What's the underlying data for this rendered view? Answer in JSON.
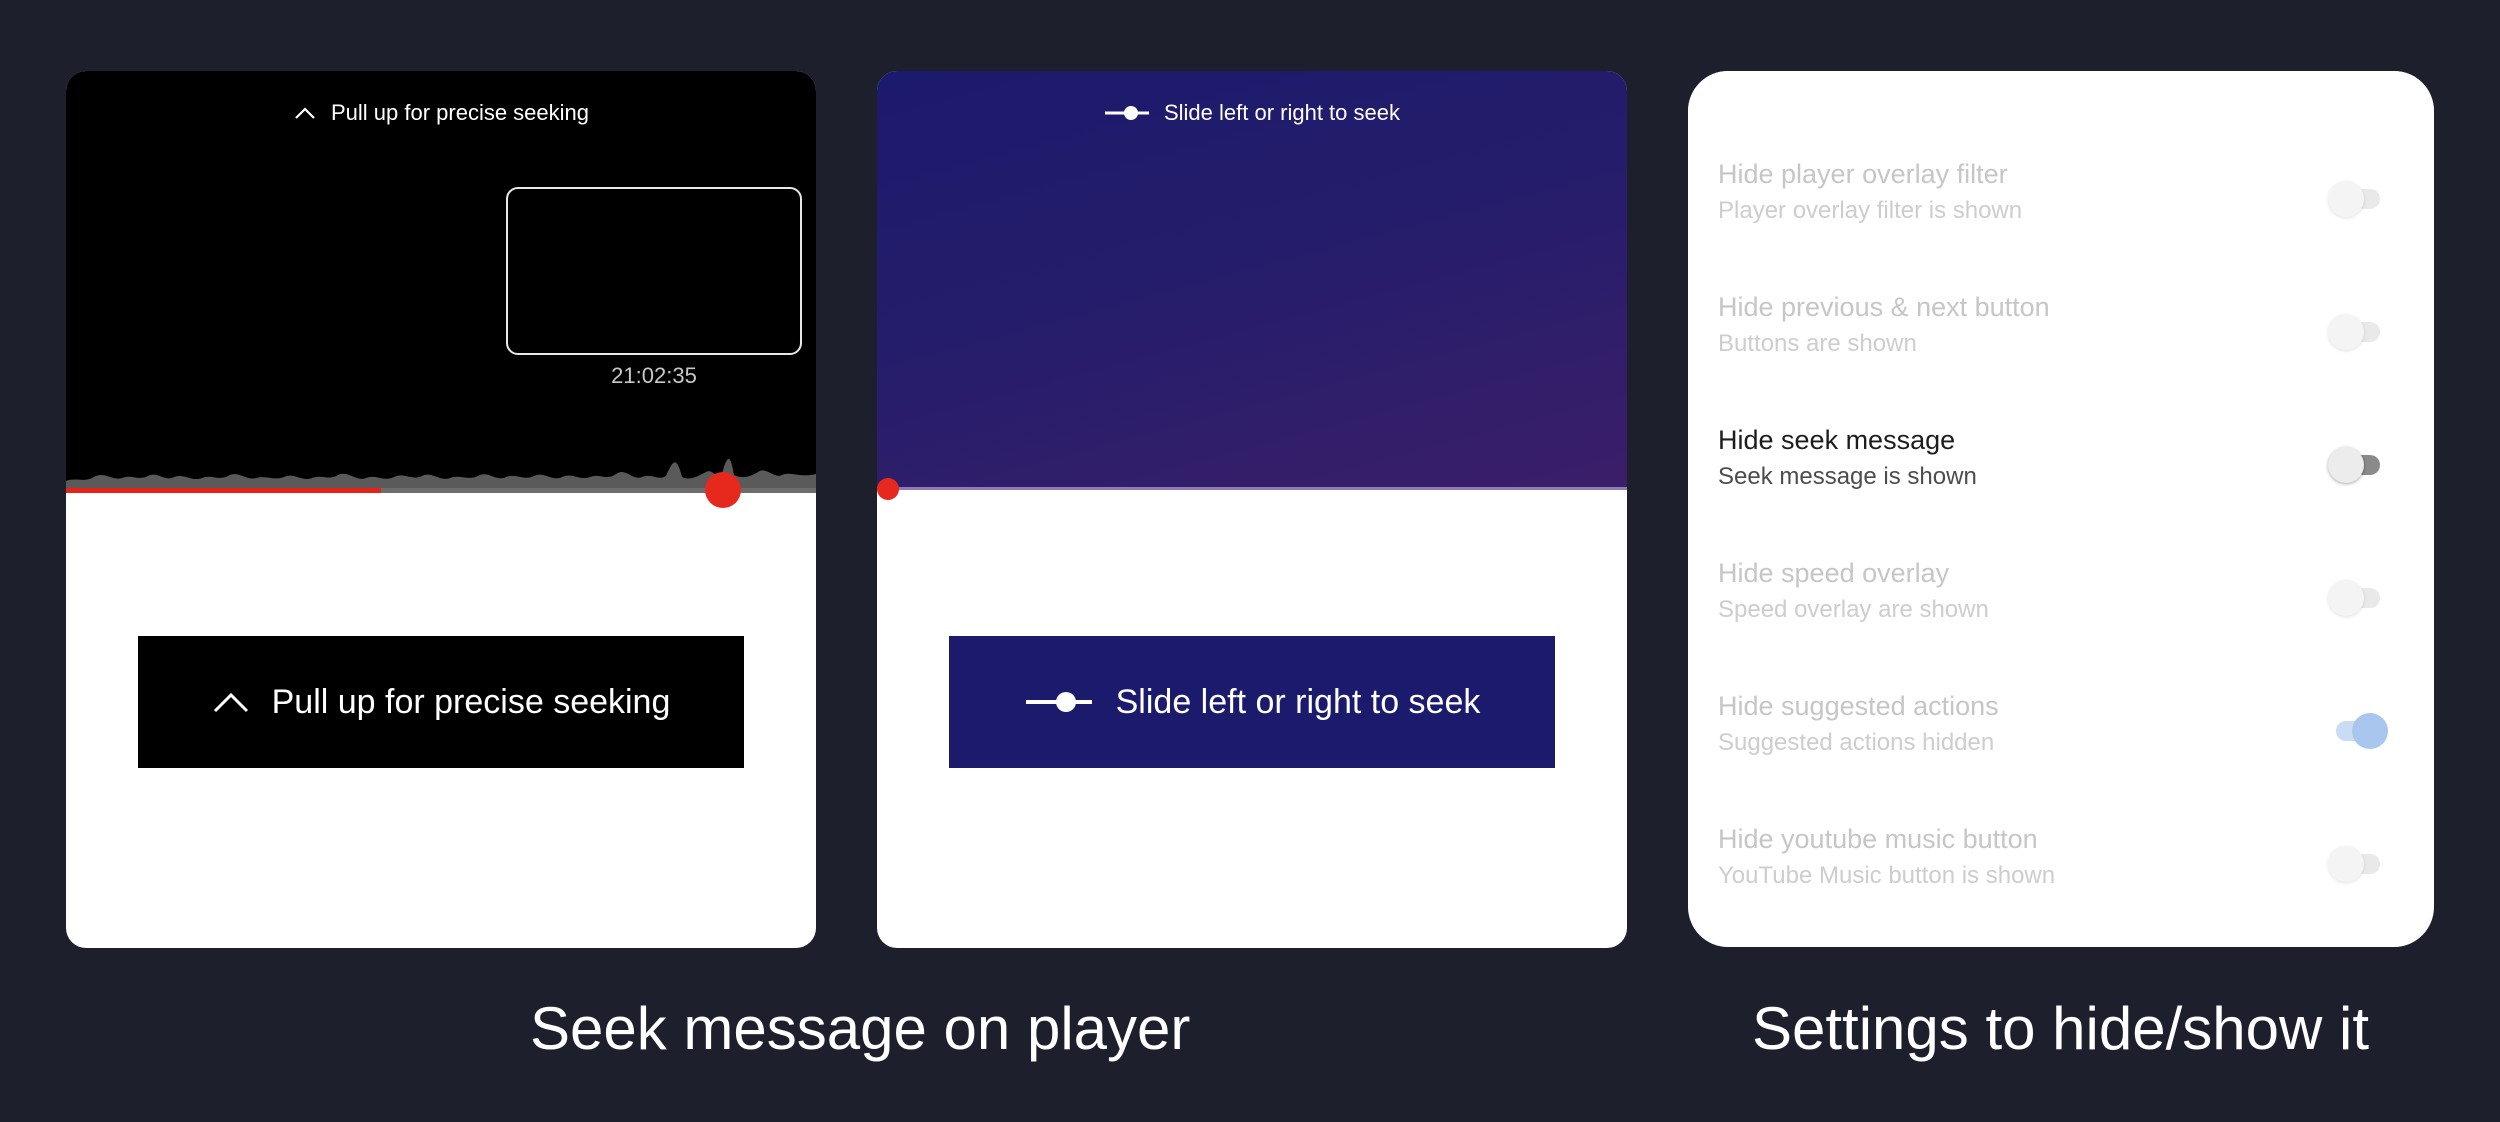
{
  "panels": {
    "left": {
      "top_hint": "Pull up for precise seeking",
      "thumbnail_time": "21:02:35",
      "seek_message": "Pull up for precise seeking",
      "progress": 0.42
    },
    "middle": {
      "top_hint": "Slide left or right to seek",
      "seek_message": "Slide left or right to seek",
      "progress": 0.0
    }
  },
  "settings": {
    "items": [
      {
        "title": "Hide player overlay filter",
        "subtitle": "Player overlay filter is shown",
        "enabled": false,
        "active": false
      },
      {
        "title": "Hide previous & next button",
        "subtitle": "Buttons are shown",
        "enabled": false,
        "active": false
      },
      {
        "title": "Hide seek message",
        "subtitle": "Seek message is shown",
        "enabled": false,
        "active": true
      },
      {
        "title": "Hide speed overlay",
        "subtitle": "Speed overlay are shown",
        "enabled": false,
        "active": false
      },
      {
        "title": "Hide suggested actions",
        "subtitle": "Suggested actions hidden",
        "enabled": true,
        "active": false
      },
      {
        "title": "Hide youtube music button",
        "subtitle": "YouTube Music button is shown",
        "enabled": false,
        "active": false
      }
    ]
  },
  "captions": {
    "left": "Seek message on player",
    "right": "Settings to hide/show it"
  },
  "colors": {
    "background": "#1d1f2d",
    "seek_red": "#e6291c",
    "purple_box": "#1c1a6c",
    "toggle_on": "#a9c7ee"
  },
  "icons": {
    "pull_up": "chevron-up-icon",
    "slide": "slider-icon"
  }
}
